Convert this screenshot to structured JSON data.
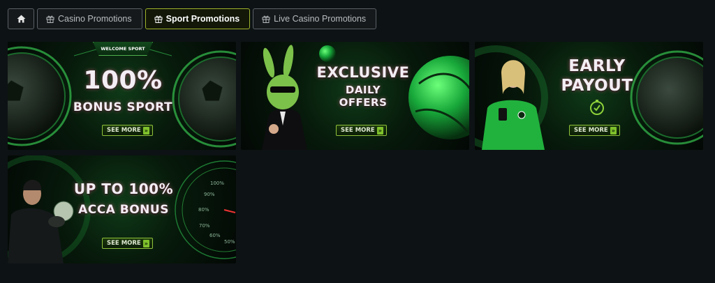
{
  "tabs": [
    {
      "label": "",
      "icon": "home-icon"
    },
    {
      "label": "Casino Promotions",
      "icon": "gift-icon"
    },
    {
      "label": "Sport Promotions",
      "icon": "gift-icon",
      "active": true
    },
    {
      "label": "Live Casino Promotions",
      "icon": "gift-icon"
    }
  ],
  "promotions": [
    {
      "badge": "WELCOME SPORT",
      "line1": "100%",
      "line2": "BONUS SPORT",
      "cta": "SEE MORE"
    },
    {
      "line1": "EXCLUSIVE",
      "line2": "DAILY",
      "line3": "OFFERS",
      "cta": "SEE MORE"
    },
    {
      "line1": "EARLY",
      "line2": "PAYOUT",
      "cta": "SEE MORE"
    },
    {
      "line1": "UP TO 100%",
      "line2": "ACCA BONUS",
      "cta": "SEE MORE",
      "gauge_labels": [
        "100%",
        "90%",
        "80%",
        "70%",
        "60%",
        "50%"
      ]
    }
  ],
  "colors": {
    "accent": "#9fb32a",
    "green": "#2bd14a",
    "background": "#0d1214"
  }
}
